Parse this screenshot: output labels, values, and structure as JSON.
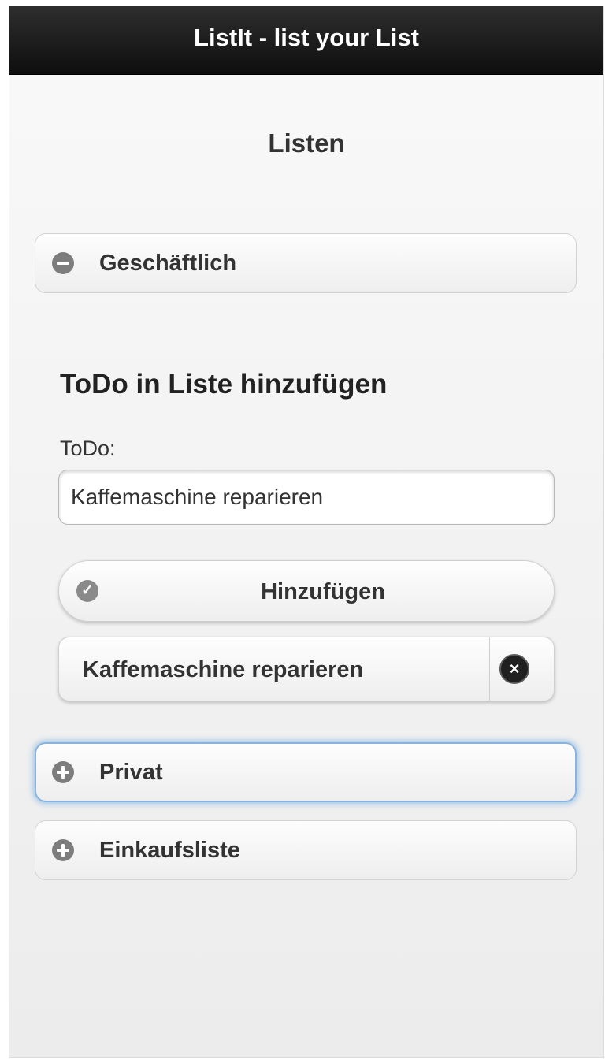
{
  "header": {
    "title": "ListIt - list your List"
  },
  "page": {
    "title": "Listen"
  },
  "lists": [
    {
      "label": "Geschäftlich",
      "state": "expanded",
      "icon": "minus-circle-icon"
    },
    {
      "label": "Privat",
      "state": "collapsed",
      "icon": "plus-circle-icon",
      "focused": true
    },
    {
      "label": "Einkaufsliste",
      "state": "collapsed",
      "icon": "plus-circle-icon"
    }
  ],
  "add_form": {
    "heading": "ToDo in Liste hinzufügen",
    "field_label": "ToDo:",
    "field_value": "Kaffemaschine reparieren",
    "submit_label": "Hinzufügen",
    "submit_icon": "check-circle-icon"
  },
  "todo_items": [
    {
      "label": "Kaffemaschine reparieren",
      "action_icon": "delete-circle-icon"
    }
  ],
  "colors": {
    "header_bg": "#111111",
    "focus_ring": "#388cdc",
    "icon_grey": "#7d7d7d"
  }
}
